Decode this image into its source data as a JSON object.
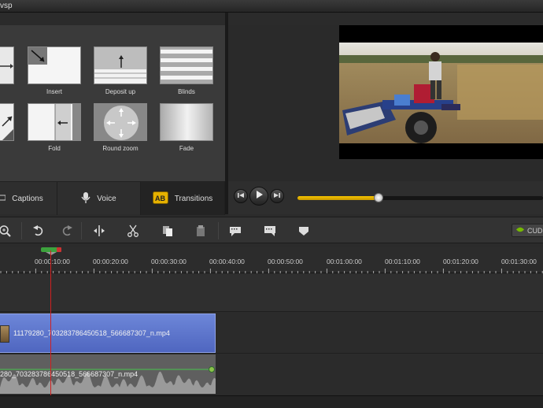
{
  "window": {
    "title": "vsp"
  },
  "transitions": {
    "tiles": [
      {
        "label": ""
      },
      {
        "label": "Insert"
      },
      {
        "label": "Deposit up"
      },
      {
        "label": "Blinds"
      },
      {
        "label": ""
      },
      {
        "label": "Fold"
      },
      {
        "label": "Round zoom"
      },
      {
        "label": "Fade"
      }
    ]
  },
  "tabs": [
    {
      "label": "Captions",
      "icon": "captions-icon"
    },
    {
      "label": "Voice",
      "icon": "microphone-icon"
    },
    {
      "label": "Transitions",
      "icon": "ab-transition-icon",
      "active": true
    }
  ],
  "player": {
    "progress": 0.33
  },
  "toolbar": {
    "cuda_label": "CUD",
    "icons": [
      "zoom-in-icon",
      "undo-icon",
      "redo-icon",
      "split-icon",
      "cut-icon",
      "copy-icon",
      "paste-icon",
      "caption-marker-icon",
      "speech-bubble-icon",
      "marker-icon"
    ]
  },
  "ruler": {
    "labels": [
      "00:00:10:00",
      "00:00:20:00",
      "00:00:30:00",
      "00:00:40:00",
      "00:00:50:00",
      "00:01:00:00",
      "00:01:10:00",
      "00:01:20:00",
      "00:01:30:00"
    ]
  },
  "timeline": {
    "video_clip_name": "11179280_703283786450518_566687307_n.mp4",
    "audio_clip_name": "280_703283786450518_566687307_n.mp4"
  },
  "colors": {
    "accent": "#f6c400",
    "video_clip": "#5a72cc",
    "playhead": "#d02020"
  }
}
